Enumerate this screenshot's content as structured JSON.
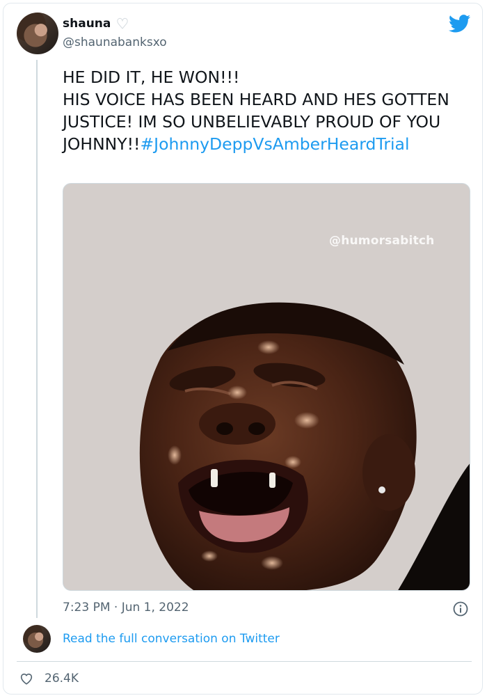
{
  "tweet": {
    "user_name": "shauna",
    "user_handle": "@shaunabanksxo",
    "text_main": "HE DID IT, HE WON!!!\nHIS VOICE HAS BEEN HEARD AND HES GOTTEN JUSTICE! IM SO UNBELIEVABLY PROUD OF YOU\nJOHNNY!!",
    "hashtag": "#JohnnyDeppVsAmberHeardTrial",
    "media_watermark": "@humorsabitch",
    "timestamp": "7:23 PM · Jun 1, 2022"
  },
  "footer": {
    "read_link": "Read the full conversation on Twitter",
    "like_count": "26.4K"
  },
  "icons": {
    "brand": "twitter-bird-icon",
    "name_badge": "white-heart-icon",
    "info": "info-icon",
    "like": "heart-outline-icon"
  },
  "colors": {
    "accent": "#1d9bf0",
    "text": "#0f1419",
    "muted": "#536471"
  }
}
